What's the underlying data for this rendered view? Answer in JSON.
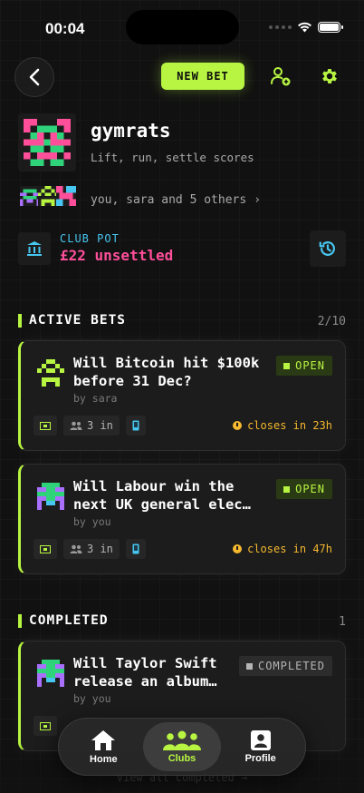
{
  "status": {
    "time": "00:04"
  },
  "header": {
    "new_bet_label": "NEW BET"
  },
  "club": {
    "name": "gymrats",
    "tagline": "Lift, run, settle scores",
    "members_text": "you, sara and 5 others",
    "members_chevron": "›",
    "pot_label": "CLUB POT",
    "pot_value": "£22 unsettled"
  },
  "active_bets": {
    "title": "ACTIVE BETS",
    "count": "2/10",
    "items": [
      {
        "title": "Will Bitcoin hit $100k before 31 Dec?",
        "by": "by sara",
        "status": "OPEN",
        "participants": "3 in",
        "closes": "closes in 23h"
      },
      {
        "title": "Will Labour win the next UK general elec…",
        "by": "by you",
        "status": "OPEN",
        "participants": "3 in",
        "closes": "closes in 47h"
      }
    ]
  },
  "completed": {
    "title": "COMPLETED",
    "count": "1",
    "items": [
      {
        "title": "Will Taylor Swift release an album…",
        "by": "by you",
        "status": "COMPLETED"
      }
    ],
    "view_all": "View all completed →"
  },
  "nav": {
    "items": [
      {
        "label": "Home",
        "icon": "home-icon"
      },
      {
        "label": "Clubs",
        "icon": "clubs-icon"
      },
      {
        "label": "Profile",
        "icon": "profile-icon"
      }
    ]
  },
  "colors": {
    "accent": "#b7f542",
    "pink": "#ff4f9a",
    "cyan": "#46c6f0",
    "amber": "#f5b82e",
    "background": "#111111"
  }
}
